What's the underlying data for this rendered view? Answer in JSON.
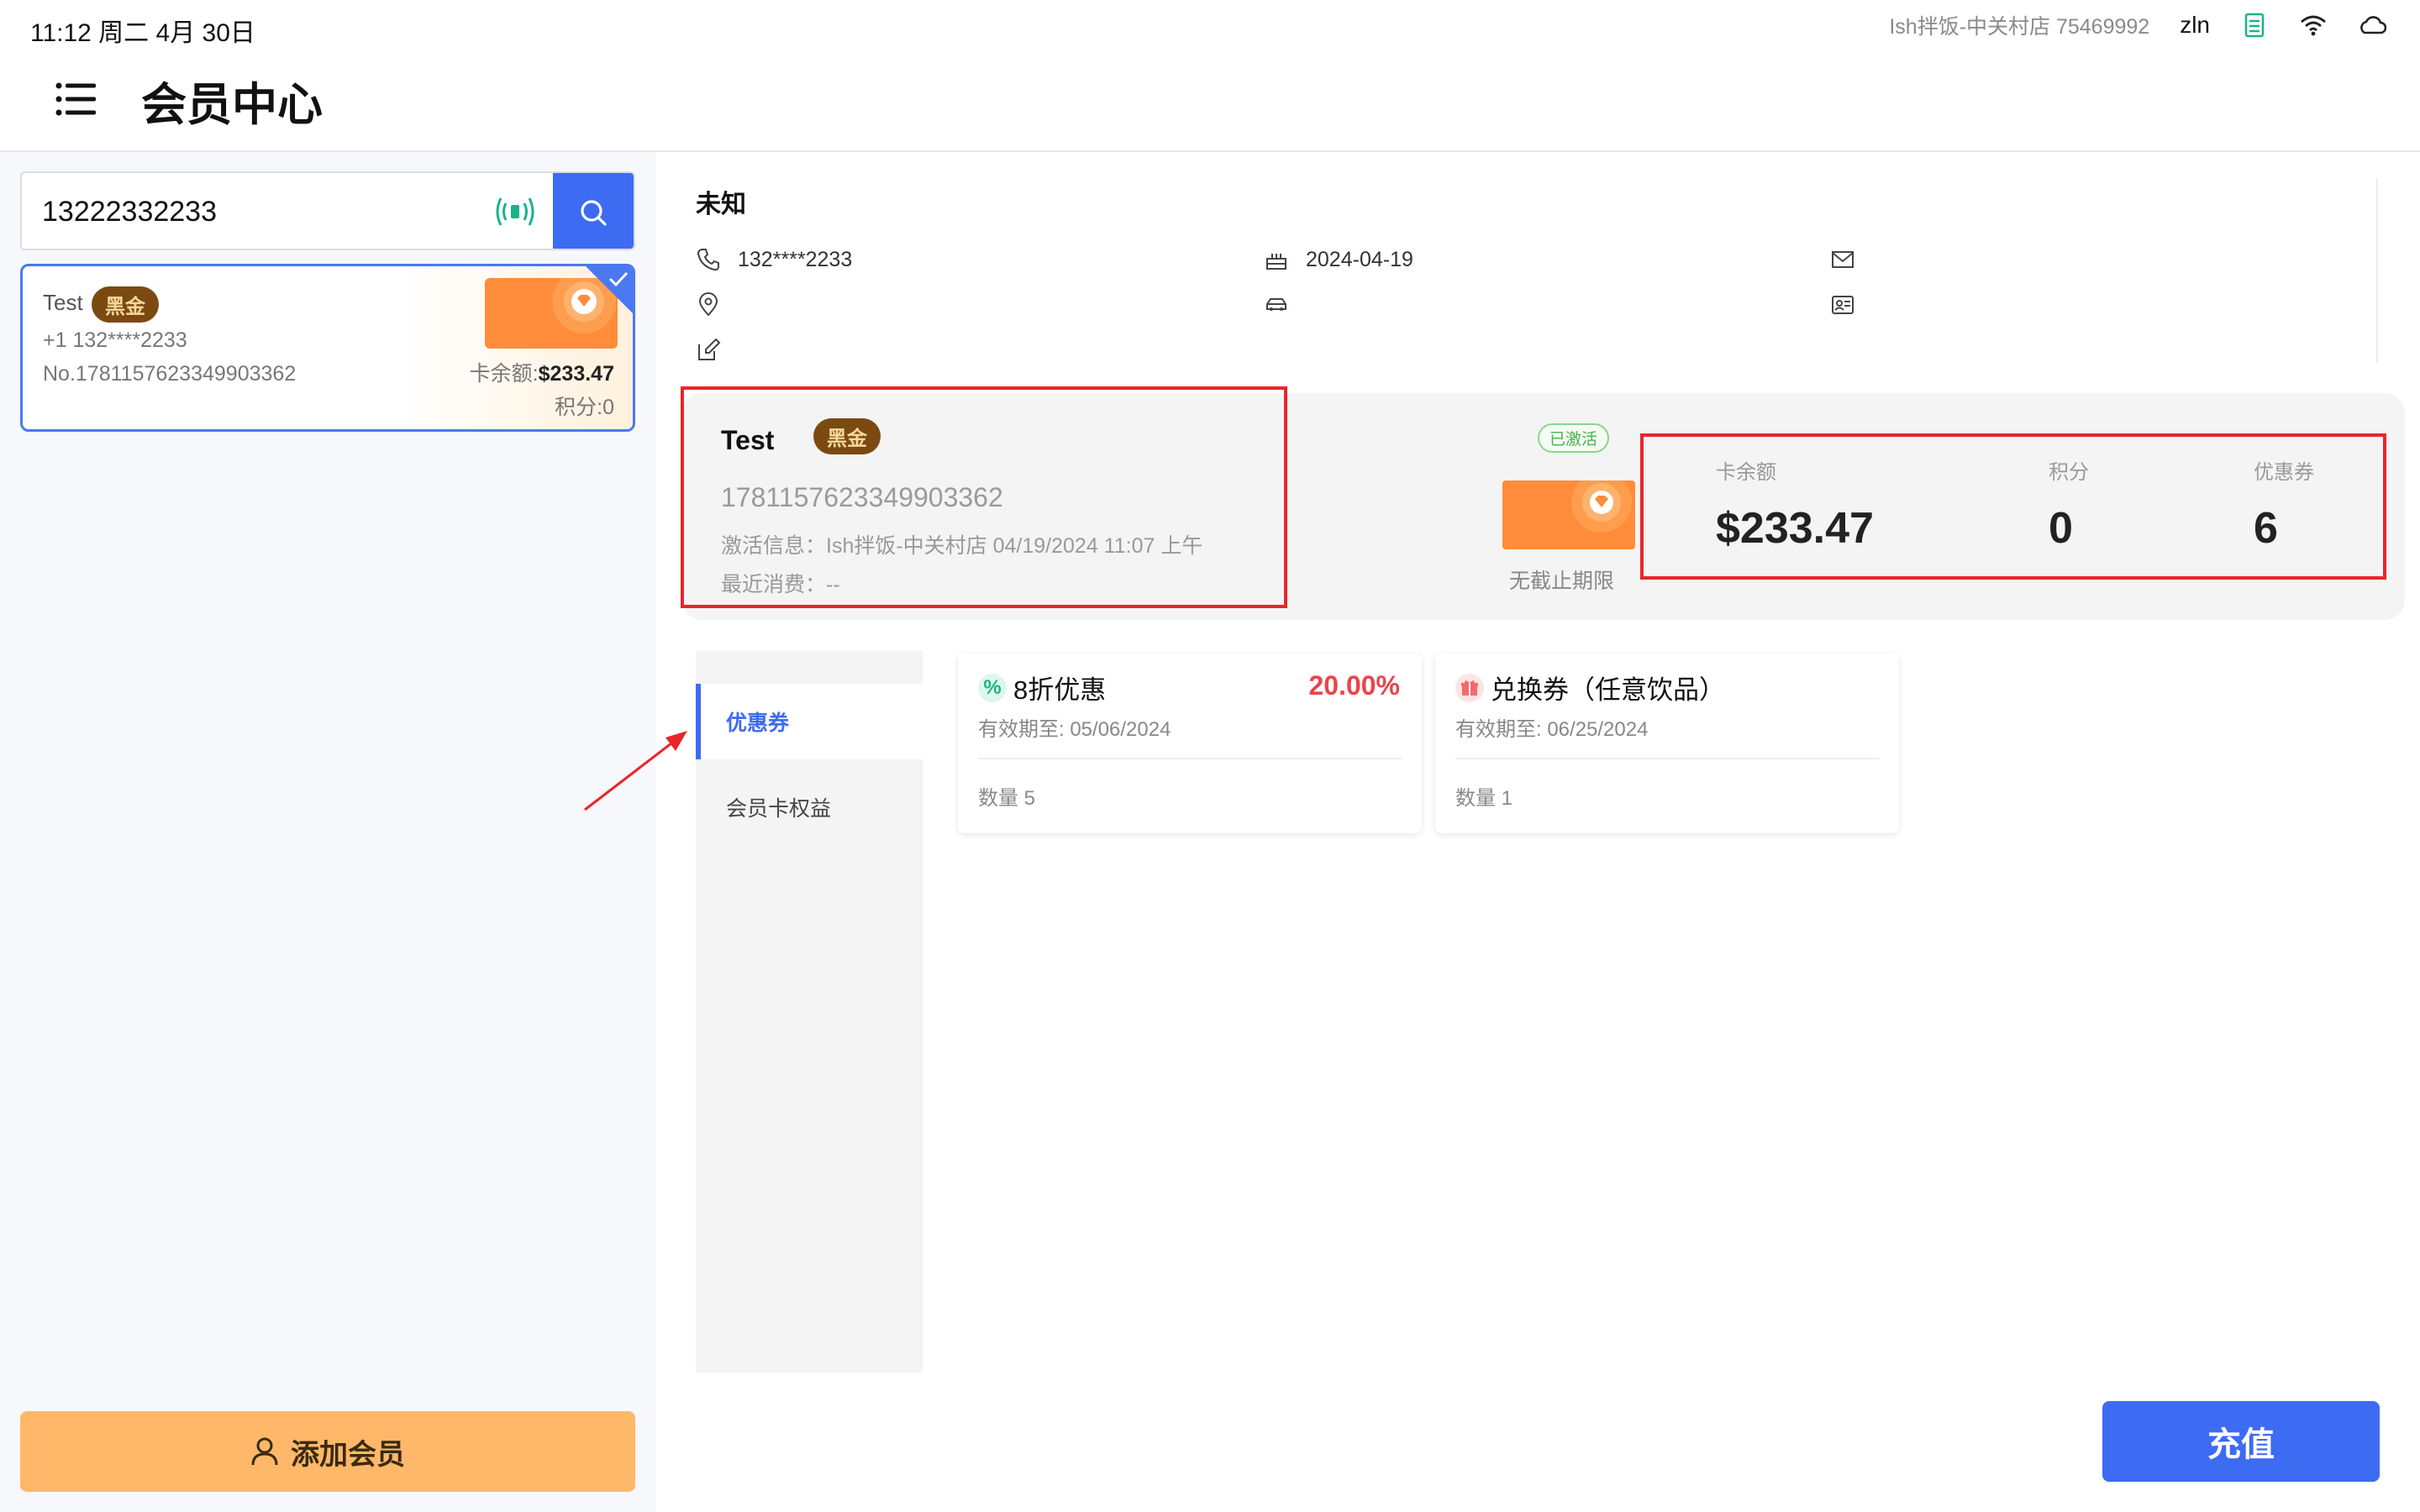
{
  "status_bar": {
    "time": "11:12 周二 4月 30日",
    "store": "Ish拌饭-中关村店  75469992",
    "user": "zln"
  },
  "header": {
    "title": "会员中心"
  },
  "search": {
    "value": "13222332233"
  },
  "member_list": [
    {
      "name": "Test",
      "level": "黑金",
      "phone": "+1 132****2233",
      "number": "No.1781157623349903362",
      "balance_label": "卡余额:",
      "balance": "$233.47",
      "points": "积分:0"
    }
  ],
  "add_member_label": "添加会员",
  "profile": {
    "name": "未知",
    "phone": "132****2233",
    "birthday": "2024-04-19"
  },
  "card": {
    "name": "Test",
    "level": "黑金",
    "number": "1781157623349903362",
    "activation": "激活信息：Ish拌饭-中关村店  04/19/2024 11:07 上午",
    "last_spend": "最近消费：--",
    "status": "已激活",
    "expiry": "无截止期限"
  },
  "stats": {
    "balance_label": "卡余额",
    "balance": "$233.47",
    "points_label": "积分",
    "points": "0",
    "coupons_label": "优惠券",
    "coupons": "6"
  },
  "tabs": [
    {
      "label": "优惠券",
      "active": true
    },
    {
      "label": "会员卡权益",
      "active": false
    }
  ],
  "coupons": [
    {
      "icon": "%",
      "title": "8折优惠",
      "percent": "20.00%",
      "valid": "有效期至: 05/06/2024",
      "quantity": "数量 5"
    },
    {
      "icon": "gift-icon",
      "title": "兑换券（任意饮品）",
      "valid": "有效期至: 06/25/2024",
      "quantity": "数量 1"
    }
  ],
  "recharge_label": "充值",
  "colors": {
    "primary": "#3d6bf2",
    "add_button": "#ffb86a",
    "badge": "#7a4a12",
    "highlight": "#e8262a",
    "discount": "#e8454b"
  }
}
